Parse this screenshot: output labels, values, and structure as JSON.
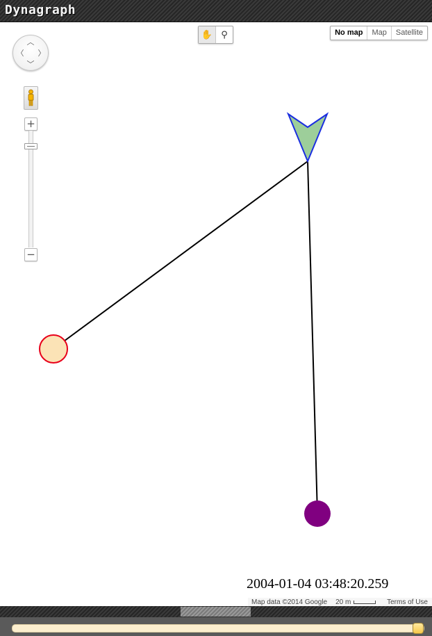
{
  "app": {
    "title": "Dynagraph"
  },
  "map_controls": {
    "pan_icons": [
      "chevron-up-icon",
      "chevron-down-icon",
      "chevron-left-icon",
      "chevron-right-icon"
    ],
    "zoom_in": "+",
    "zoom_out": "−",
    "zoom_level_fraction": 0.1
  },
  "tools": [
    {
      "name": "drag-tool",
      "icon": "hand-icon",
      "glyph": "✋",
      "active": true
    },
    {
      "name": "marker-tool",
      "icon": "pin-icon",
      "glyph": "⚲",
      "active": false
    }
  ],
  "map_types": [
    {
      "label": "No map",
      "active": true
    },
    {
      "label": "Map",
      "active": false
    },
    {
      "label": "Satellite",
      "active": false
    }
  ],
  "graph": {
    "colors": {
      "edge": "#000000",
      "arrow_fill": "#9dce9a",
      "arrow_stroke": "#1a2ee0",
      "node_light_fill": "#fbe3b6",
      "node_light_stroke": "#e8001a",
      "node_purple": "#800080"
    }
  },
  "timestamp": "2004-01-04 03:48:20.259",
  "attribution": {
    "map_data": "Map data ©2014 Google",
    "scale": "20 m",
    "terms": "Terms of Use"
  },
  "timeline": {
    "position_fraction": 1.0
  }
}
